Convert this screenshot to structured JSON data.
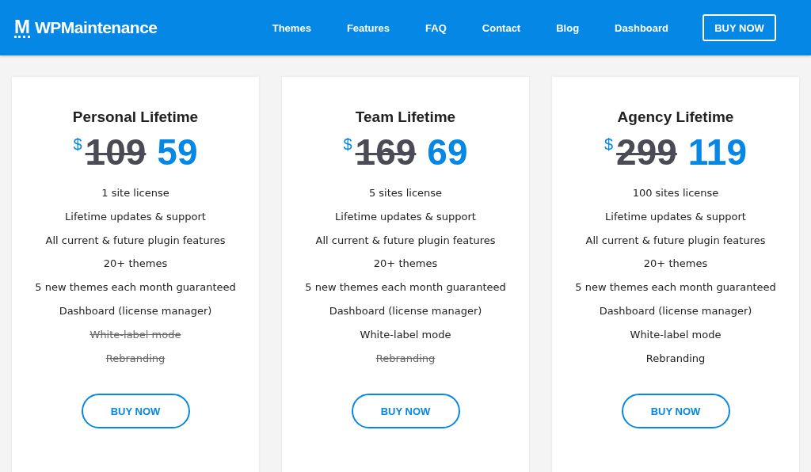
{
  "header": {
    "logo_mark": "M",
    "logo_text": "WPMaintenance",
    "nav": [
      {
        "label": "Themes"
      },
      {
        "label": "Features"
      },
      {
        "label": "FAQ"
      },
      {
        "label": "Contact"
      },
      {
        "label": "Blog"
      },
      {
        "label": "Dashboard"
      }
    ],
    "cta": "BUY NOW"
  },
  "plans": [
    {
      "title": "Personal Lifetime",
      "currency": "$",
      "old_price": "109",
      "price": "59",
      "features": [
        {
          "text": "1 site license",
          "included": true
        },
        {
          "text": "Lifetime updates & support",
          "included": true
        },
        {
          "text": "All current & future plugin features",
          "included": true
        },
        {
          "text": "20+ themes",
          "included": true
        },
        {
          "text": "5 new themes each month guaranteed",
          "included": true
        },
        {
          "text": "Dashboard (license manager)",
          "included": true
        },
        {
          "text": "White-label mode",
          "included": false
        },
        {
          "text": "Rebranding",
          "included": false
        }
      ],
      "button": "BUY NOW"
    },
    {
      "title": "Team Lifetime",
      "currency": "$",
      "old_price": "169",
      "price": "69",
      "features": [
        {
          "text": "5 sites license",
          "included": true
        },
        {
          "text": "Lifetime updates & support",
          "included": true
        },
        {
          "text": "All current & future plugin features",
          "included": true
        },
        {
          "text": "20+ themes",
          "included": true
        },
        {
          "text": "5 new themes each month guaranteed",
          "included": true
        },
        {
          "text": "Dashboard (license manager)",
          "included": true
        },
        {
          "text": "White-label mode",
          "included": true
        },
        {
          "text": "Rebranding",
          "included": false
        }
      ],
      "button": "BUY NOW"
    },
    {
      "title": "Agency Lifetime",
      "currency": "$",
      "old_price": "299",
      "price": "119",
      "features": [
        {
          "text": "100 sites license",
          "included": true
        },
        {
          "text": "Lifetime updates & support",
          "included": true
        },
        {
          "text": "All current & future plugin features",
          "included": true
        },
        {
          "text": "20+ themes",
          "included": true
        },
        {
          "text": "5 new themes each month guaranteed",
          "included": true
        },
        {
          "text": "Dashboard (license manager)",
          "included": true
        },
        {
          "text": "White-label mode",
          "included": true
        },
        {
          "text": "Rebranding",
          "included": true
        }
      ],
      "button": "BUY NOW"
    }
  ]
}
